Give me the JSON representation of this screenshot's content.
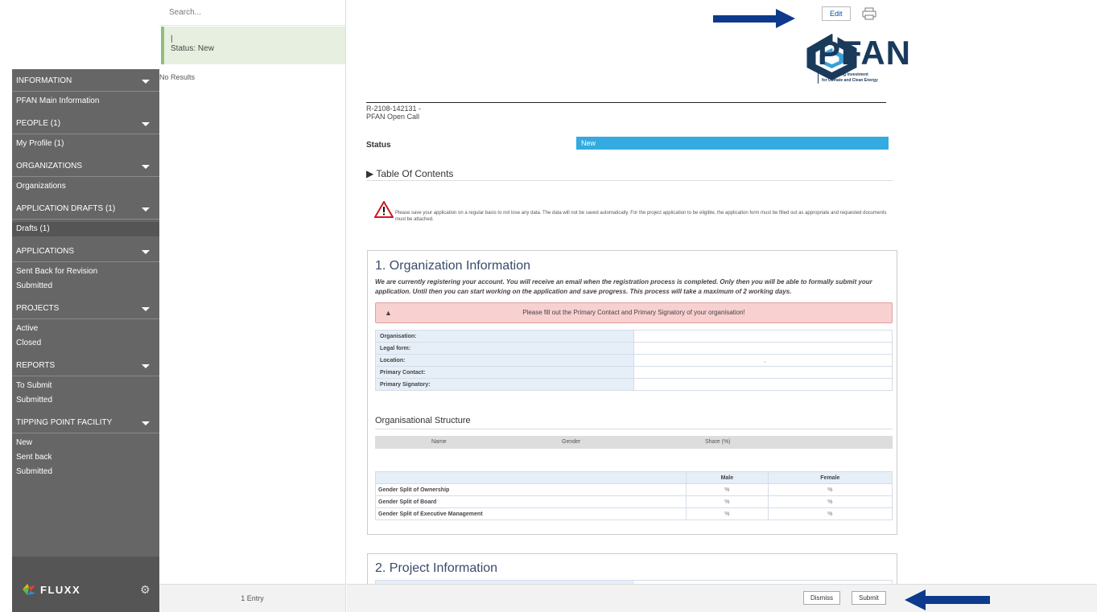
{
  "search": {
    "placeholder": "Search..."
  },
  "list": {
    "card_line1": "|",
    "card_status": "Status: New",
    "no_results": "No Results",
    "footer_count": "1 Entry"
  },
  "nav": {
    "sections": [
      {
        "header": "INFORMATION",
        "items": [
          "PFAN Main Information"
        ]
      },
      {
        "header": "PEOPLE (1)",
        "items": [
          "My Profile  (1)"
        ]
      },
      {
        "header": "ORGANIZATIONS",
        "items": [
          "Organizations"
        ]
      },
      {
        "header": "APPLICATION DRAFTS (1)",
        "items": [
          "Drafts  (1)"
        ]
      },
      {
        "header": "APPLICATIONS",
        "items": [
          "Sent Back for Revision",
          "Submitted"
        ]
      },
      {
        "header": "PROJECTS",
        "items": [
          "Active",
          "Closed"
        ]
      },
      {
        "header": "REPORTS",
        "items": [
          "To Submit",
          "Submitted"
        ]
      },
      {
        "header": "TIPPING POINT FACILITY",
        "items": [
          "New",
          "Sent back",
          "Submitted"
        ]
      }
    ],
    "active_item": "Drafts  (1)",
    "logo_text": "FLUXX"
  },
  "toolbar": {
    "edit_label": "Edit"
  },
  "brand": {
    "name": "PFAN",
    "tagline_1": "Accelerating Investment",
    "tagline_2": "for Climate and Clean Energy",
    "color": "#1a3a5c"
  },
  "record": {
    "id_line": "R-2108-142131 -",
    "program": "PFAN Open Call",
    "status_label": "Status",
    "status_value": "New",
    "status_color": "#33aae0",
    "toc_label": "▶ Table Of Contents"
  },
  "warning": {
    "text": "Please save your application on a regular basis to not lose any data. The data will not be saved automatically. For the project application to be eligible, the application form must be filled out as appropriate and requested documents must be attached."
  },
  "section1": {
    "title": "1. Organization Information",
    "note": "We are currently registering your account. You will receive an email when the registration process is completed. Only then you will be able to formally submit your application. Until then you can start working on the application and save progress. This process will take a maximum of 2 working days.",
    "alert": "Please fill out the Primary Contact and Primary Signatory of your organisation!",
    "fields": [
      {
        "label": "Organisation:",
        "value": ""
      },
      {
        "label": "Legal form:",
        "value": ""
      },
      {
        "label": "Location:",
        "value": ","
      },
      {
        "label": "Primary Contact:",
        "value": ""
      },
      {
        "label": "Primary Signatory:",
        "value": ""
      }
    ],
    "structure_title": "Organisational Structure",
    "structure_columns": [
      "Name",
      "Gender",
      "Share (%)"
    ],
    "gender_columns": [
      "Male",
      "Female"
    ],
    "gender_rows": [
      {
        "label": "Gender Split of Ownership",
        "male": "%",
        "female": "%"
      },
      {
        "label": "Gender Split of Board",
        "male": "%",
        "female": "%"
      },
      {
        "label": "Gender Split of Executive Management",
        "male": "%",
        "female": "%"
      }
    ]
  },
  "section2": {
    "title": "2. Project Information"
  },
  "actions": {
    "dismiss_label": "Dismiss",
    "submit_label": "Submit"
  },
  "colors": {
    "sidebar": "#666666",
    "arrow": "#0d3a8c",
    "alert_bg": "#f8d0d0"
  }
}
